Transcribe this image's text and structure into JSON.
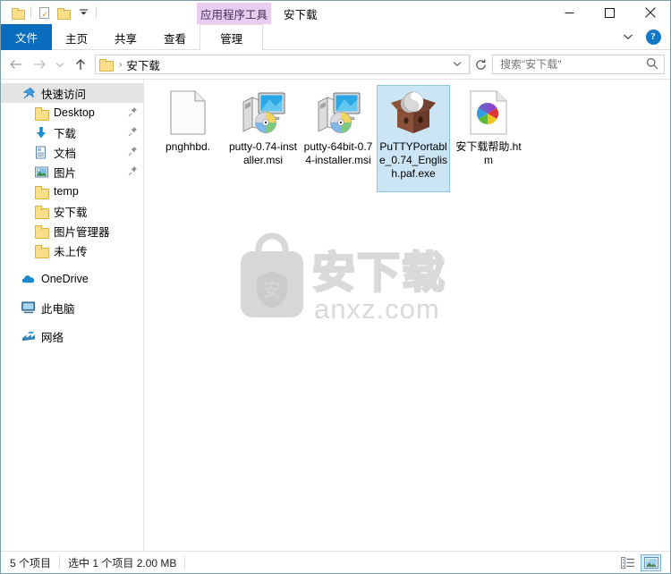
{
  "window": {
    "title": "安下载",
    "contextual_tool_header": "应用程序工具",
    "controls": {
      "minimize": "minimize-icon",
      "maximize": "maximize-icon",
      "close": "close-icon"
    }
  },
  "quick_access_toolbar": {
    "items": [
      {
        "name": "properties-folder",
        "icon": "folder-icon"
      },
      {
        "name": "properties",
        "icon": "document-check-icon"
      },
      {
        "name": "new-folder",
        "icon": "folder-icon"
      },
      {
        "name": "customize",
        "icon": "chevron-down-icon"
      }
    ]
  },
  "ribbon": {
    "tabs": [
      {
        "label": "文件",
        "type": "file",
        "selected": false
      },
      {
        "label": "主页",
        "type": "plain",
        "selected": false
      },
      {
        "label": "共享",
        "type": "plain",
        "selected": false
      },
      {
        "label": "查看",
        "type": "plain",
        "selected": false
      },
      {
        "label": "管理",
        "type": "manage",
        "selected": true
      }
    ],
    "collapse_icon": "chevron-down-icon",
    "help_label": "?"
  },
  "address_bar": {
    "back_icon": "arrow-left-icon",
    "forward_icon": "arrow-right-icon",
    "recent_icon": "chevron-down-icon",
    "up_icon": "arrow-up-icon",
    "breadcrumb": {
      "folder_icon": "folder-icon",
      "separator": "›",
      "path": "安下载"
    },
    "dropdown_icon": "chevron-down-icon",
    "refresh_icon": "refresh-icon"
  },
  "search": {
    "placeholder": "搜索\"安下载\"",
    "value": "",
    "icon": "search-icon"
  },
  "sidebar": {
    "items": [
      {
        "label": "快速访问",
        "icon": "pin-star-icon",
        "level": "root",
        "selected": true,
        "pinned": false
      },
      {
        "label": "Desktop",
        "icon": "folder-icon",
        "level": "child",
        "selected": false,
        "pinned": true
      },
      {
        "label": "下载",
        "icon": "download-arrow-icon",
        "level": "child",
        "selected": false,
        "pinned": true
      },
      {
        "label": "文档",
        "icon": "documents-icon",
        "level": "child",
        "selected": false,
        "pinned": true
      },
      {
        "label": "图片",
        "icon": "pictures-icon",
        "level": "child",
        "selected": false,
        "pinned": true
      },
      {
        "label": "temp",
        "icon": "folder-icon",
        "level": "child",
        "selected": false,
        "pinned": false
      },
      {
        "label": "安下载",
        "icon": "folder-icon",
        "level": "child",
        "selected": false,
        "pinned": false
      },
      {
        "label": "图片管理器",
        "icon": "folder-icon",
        "level": "child",
        "selected": false,
        "pinned": false
      },
      {
        "label": "未上传",
        "icon": "folder-icon",
        "level": "child",
        "selected": false,
        "pinned": false
      },
      {
        "label": "OneDrive",
        "icon": "onedrive-cloud-icon",
        "level": "root",
        "selected": false,
        "pinned": false
      },
      {
        "label": "此电脑",
        "icon": "this-pc-icon",
        "level": "root",
        "selected": false,
        "pinned": false
      },
      {
        "label": "网络",
        "icon": "network-icon",
        "level": "root",
        "selected": false,
        "pinned": false
      }
    ],
    "pin_icon": "pushpin-icon"
  },
  "files": [
    {
      "name": "pnghhbd.",
      "icon": "blank-document-icon",
      "selected": false
    },
    {
      "name": "putty-0.74-installer.msi",
      "icon": "msi-installer-icon",
      "selected": false
    },
    {
      "name": "putty-64bit-0.74-installer.msi",
      "icon": "msi-installer-icon",
      "selected": false
    },
    {
      "name": "PuTTYPortable_0.74_English.paf.exe",
      "icon": "puttyportable-icon",
      "selected": true
    },
    {
      "name": "安下载帮助.htm",
      "icon": "html-pinwheel-icon",
      "selected": false
    }
  ],
  "watermark": {
    "text_cn": "安下载",
    "text_en": "anxz.com",
    "badge_char": "安",
    "color": "#d8d8d8"
  },
  "status_bar": {
    "item_count": "5 个项目",
    "selection": "选中 1 个项目  2.00 MB",
    "views": [
      {
        "name": "details-view",
        "icon": "details-view-icon",
        "active": false
      },
      {
        "name": "large-icons-view",
        "icon": "large-icons-view-icon",
        "active": true
      }
    ]
  },
  "colors": {
    "file_tab_blue": "#0a6cbc",
    "contextual_purple": "#e9cdf0",
    "selection_blue": "#cce5f4",
    "window_border": "#7ea0ab"
  }
}
